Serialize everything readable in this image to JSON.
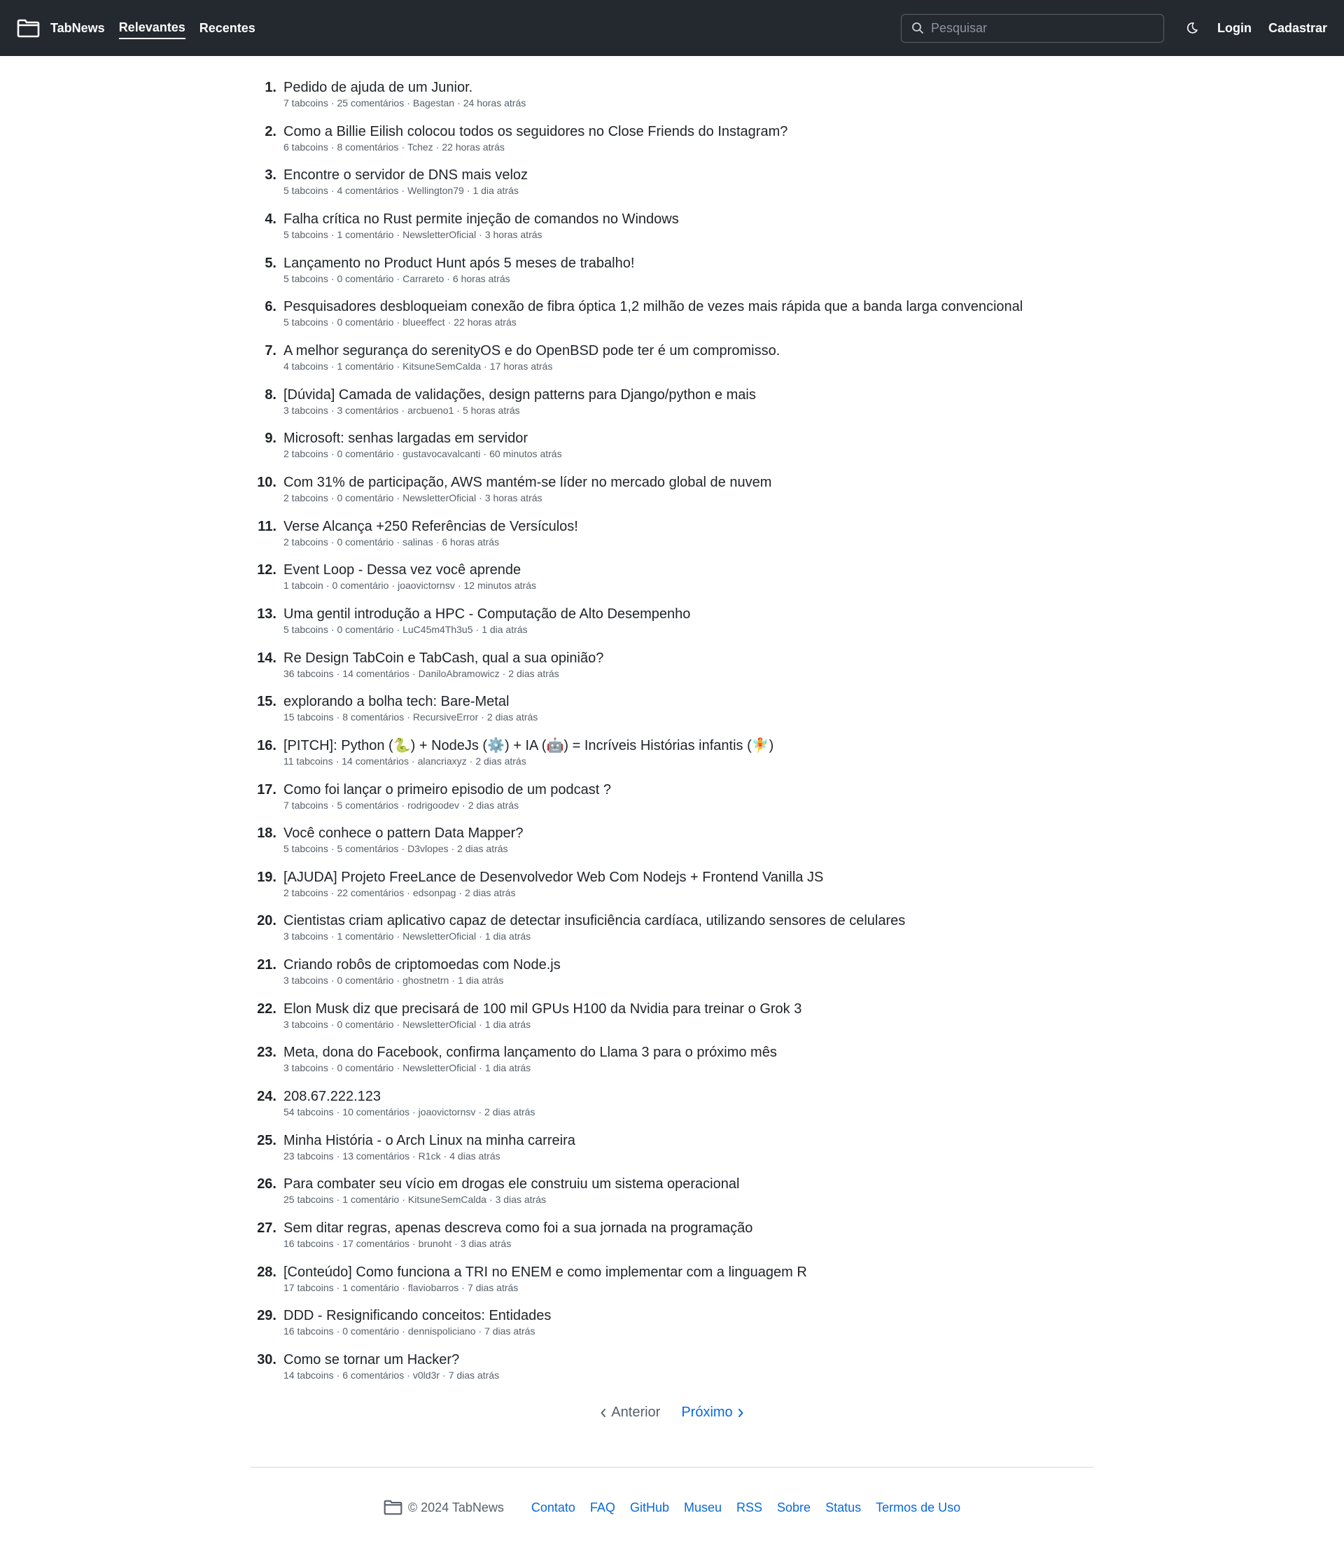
{
  "header": {
    "brand": "TabNews",
    "nav": [
      "Relevantes",
      "Recentes"
    ],
    "search_placeholder": "Pesquisar",
    "login": "Login",
    "signup": "Cadastrar"
  },
  "posts": [
    {
      "rank": "1.",
      "title": "Pedido de ajuda de um Junior.",
      "tabcoins": "7 tabcoins",
      "comments": "25 comentários",
      "author": "Bagestan",
      "time": "24 horas atrás"
    },
    {
      "rank": "2.",
      "title": "Como a Billie Eilish colocou todos os seguidores no Close Friends do Instagram?",
      "tabcoins": "6 tabcoins",
      "comments": "8 comentários",
      "author": "Tchez",
      "time": "22 horas atrás"
    },
    {
      "rank": "3.",
      "title": "Encontre o servidor de DNS mais veloz",
      "tabcoins": "5 tabcoins",
      "comments": "4 comentários",
      "author": "Wellington79",
      "time": "1 dia atrás"
    },
    {
      "rank": "4.",
      "title": "Falha crítica no Rust permite injeção de comandos no Windows",
      "tabcoins": "5 tabcoins",
      "comments": "1 comentário",
      "author": "NewsletterOficial",
      "time": "3 horas atrás"
    },
    {
      "rank": "5.",
      "title": "Lançamento no Product Hunt após 5 meses de trabalho!",
      "tabcoins": "5 tabcoins",
      "comments": "0 comentário",
      "author": "Carrareto",
      "time": "6 horas atrás"
    },
    {
      "rank": "6.",
      "title": "Pesquisadores desbloqueiam conexão de fibra óptica 1,2 milhão de vezes mais rápida que a banda larga convencional",
      "tabcoins": "5 tabcoins",
      "comments": "0 comentário",
      "author": "blueeffect",
      "time": "22 horas atrás"
    },
    {
      "rank": "7.",
      "title": "A melhor segurança do serenityOS e do OpenBSD pode ter é um compromisso.",
      "tabcoins": "4 tabcoins",
      "comments": "1 comentário",
      "author": "KitsuneSemCalda",
      "time": "17 horas atrás"
    },
    {
      "rank": "8.",
      "title": "[Dúvida] Camada de validações, design patterns para Django/python e mais",
      "tabcoins": "3 tabcoins",
      "comments": "3 comentários",
      "author": "arcbueno1",
      "time": "5 horas atrás"
    },
    {
      "rank": "9.",
      "title": "Microsoft: senhas largadas em servidor",
      "tabcoins": "2 tabcoins",
      "comments": "0 comentário",
      "author": "gustavocavalcanti",
      "time": "60 minutos atrás"
    },
    {
      "rank": "10.",
      "title": "Com 31% de participação, AWS mantém-se líder no mercado global de nuvem",
      "tabcoins": "2 tabcoins",
      "comments": "0 comentário",
      "author": "NewsletterOficial",
      "time": "3 horas atrás"
    },
    {
      "rank": "11.",
      "title": "Verse Alcança +250 Referências de Versículos!",
      "tabcoins": "2 tabcoins",
      "comments": "0 comentário",
      "author": "salinas",
      "time": "6 horas atrás"
    },
    {
      "rank": "12.",
      "title": "Event Loop - Dessa vez você aprende",
      "tabcoins": "1 tabcoin",
      "comments": "0 comentário",
      "author": "joaovictornsv",
      "time": "12 minutos atrás"
    },
    {
      "rank": "13.",
      "title": "Uma gentil introdução a HPC - Computação de Alto Desempenho",
      "tabcoins": "5 tabcoins",
      "comments": "0 comentário",
      "author": "LuC45m4Th3u5",
      "time": "1 dia atrás"
    },
    {
      "rank": "14.",
      "title": "Re Design TabCoin e TabCash, qual a sua opinião?",
      "tabcoins": "36 tabcoins",
      "comments": "14 comentários",
      "author": "DaniloAbramowicz",
      "time": "2 dias atrás"
    },
    {
      "rank": "15.",
      "title": "explorando a bolha tech: Bare-Metal",
      "tabcoins": "15 tabcoins",
      "comments": "8 comentários",
      "author": "RecursiveError",
      "time": "2 dias atrás"
    },
    {
      "rank": "16.",
      "title": "[PITCH]: Python (🐍) + NodeJs (⚙️) + IA (🤖) = Incríveis Histórias infantis (🧚)",
      "tabcoins": "11 tabcoins",
      "comments": "14 comentários",
      "author": "alancriaxyz",
      "time": "2 dias atrás"
    },
    {
      "rank": "17.",
      "title": "Como foi lançar o primeiro episodio de um podcast ?",
      "tabcoins": "7 tabcoins",
      "comments": "5 comentários",
      "author": "rodrigoodev",
      "time": "2 dias atrás"
    },
    {
      "rank": "18.",
      "title": "Você conhece o pattern Data Mapper?",
      "tabcoins": "5 tabcoins",
      "comments": "5 comentários",
      "author": "D3vlopes",
      "time": "2 dias atrás"
    },
    {
      "rank": "19.",
      "title": "[AJUDA] Projeto FreeLance de Desenvolvedor Web Com Nodejs + Frontend Vanilla JS",
      "tabcoins": "2 tabcoins",
      "comments": "22 comentários",
      "author": "edsonpag",
      "time": "2 dias atrás"
    },
    {
      "rank": "20.",
      "title": "Cientistas criam aplicativo capaz de detectar insuficiência cardíaca, utilizando sensores de celulares",
      "tabcoins": "3 tabcoins",
      "comments": "1 comentário",
      "author": "NewsletterOficial",
      "time": "1 dia atrás"
    },
    {
      "rank": "21.",
      "title": "Criando robôs de criptomoedas com Node.js",
      "tabcoins": "3 tabcoins",
      "comments": "0 comentário",
      "author": "ghostnetrn",
      "time": "1 dia atrás"
    },
    {
      "rank": "22.",
      "title": "Elon Musk diz que precisará de 100 mil GPUs H100 da Nvidia para treinar o Grok 3",
      "tabcoins": "3 tabcoins",
      "comments": "0 comentário",
      "author": "NewsletterOficial",
      "time": "1 dia atrás"
    },
    {
      "rank": "23.",
      "title": "Meta, dona do Facebook, confirma lançamento do Llama 3 para o próximo mês",
      "tabcoins": "3 tabcoins",
      "comments": "0 comentário",
      "author": "NewsletterOficial",
      "time": "1 dia atrás"
    },
    {
      "rank": "24.",
      "title": "208.67.222.123",
      "tabcoins": "54 tabcoins",
      "comments": "10 comentários",
      "author": "joaovictornsv",
      "time": "2 dias atrás"
    },
    {
      "rank": "25.",
      "title": "Minha História - o Arch Linux na minha carreira",
      "tabcoins": "23 tabcoins",
      "comments": "13 comentários",
      "author": "R1ck",
      "time": "4 dias atrás"
    },
    {
      "rank": "26.",
      "title": "Para combater seu vício em drogas ele construiu um sistema operacional",
      "tabcoins": "25 tabcoins",
      "comments": "1 comentário",
      "author": "KitsuneSemCalda",
      "time": "3 dias atrás"
    },
    {
      "rank": "27.",
      "title": "Sem ditar regras, apenas descreva como foi a sua jornada na programação",
      "tabcoins": "16 tabcoins",
      "comments": "17 comentários",
      "author": "brunoht",
      "time": "3 dias atrás"
    },
    {
      "rank": "28.",
      "title": "[Conteúdo] Como funciona a TRI no ENEM e como implementar com a linguagem R",
      "tabcoins": "17 tabcoins",
      "comments": "1 comentário",
      "author": "flaviobarros",
      "time": "7 dias atrás"
    },
    {
      "rank": "29.",
      "title": "DDD - Resignificando conceitos: Entidades",
      "tabcoins": "16 tabcoins",
      "comments": "0 comentário",
      "author": "dennispoliciano",
      "time": "7 dias atrás"
    },
    {
      "rank": "30.",
      "title": "Como se tornar um Hacker?",
      "tabcoins": "14 tabcoins",
      "comments": "6 comentários",
      "author": "v0ld3r",
      "time": "7 dias atrás"
    }
  ],
  "meta_separator": "·",
  "pagination": {
    "prev": "Anterior",
    "next": "Próximo"
  },
  "footer": {
    "copyright": "© 2024 TabNews",
    "links": [
      "Contato",
      "FAQ",
      "GitHub",
      "Museu",
      "RSS",
      "Sobre",
      "Status",
      "Termos de Uso"
    ]
  },
  "colors": {
    "header_bg": "#24292f",
    "link": "#0969da",
    "muted": "#57606a"
  }
}
